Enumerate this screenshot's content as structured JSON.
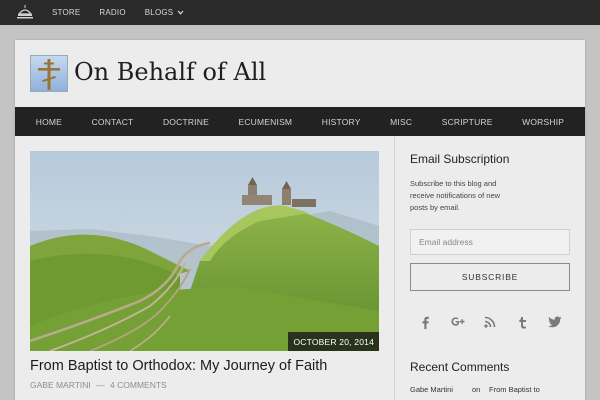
{
  "topbar": {
    "logo_icon": "dome-icon",
    "nav": [
      {
        "label": "STORE"
      },
      {
        "label": "RADIO"
      },
      {
        "label": "BLOGS",
        "has_dropdown": true
      }
    ]
  },
  "site": {
    "title": "On Behalf of All",
    "logo_icon": "orthodox-cross-icon"
  },
  "main_nav": [
    {
      "label": "HOME"
    },
    {
      "label": "CONTACT"
    },
    {
      "label": "DOCTRINE"
    },
    {
      "label": "ECUMENISM"
    },
    {
      "label": "HISTORY"
    },
    {
      "label": "MISC"
    },
    {
      "label": "SCRIPTURE"
    },
    {
      "label": "WORSHIP"
    }
  ],
  "post": {
    "date": "OCTOBER 20, 2014",
    "title": "From Baptist to Orthodox: My Journey of Faith",
    "author": "GABE MARTINI",
    "separator": "—",
    "comments": "4 COMMENTS"
  },
  "sidebar": {
    "email_title": "Email Subscription",
    "email_desc": "Subscribe to this blog and receive notifications of new posts by email.",
    "email_placeholder": "Email address",
    "subscribe_label": "SUBSCRIBE",
    "social_icons": [
      "facebook-icon",
      "google-plus-icon",
      "rss-icon",
      "tumblr-icon",
      "twitter-icon"
    ],
    "recent_title": "Recent Comments",
    "recent_comment": {
      "author": "Gabe Martini",
      "on": "on",
      "post": "From Baptist to"
    }
  },
  "colors": {
    "topbar_bg": "#2a2a2a",
    "nav_bg": "#222222",
    "page_bg": "#ececec",
    "body_bg": "#c4c4c4"
  }
}
